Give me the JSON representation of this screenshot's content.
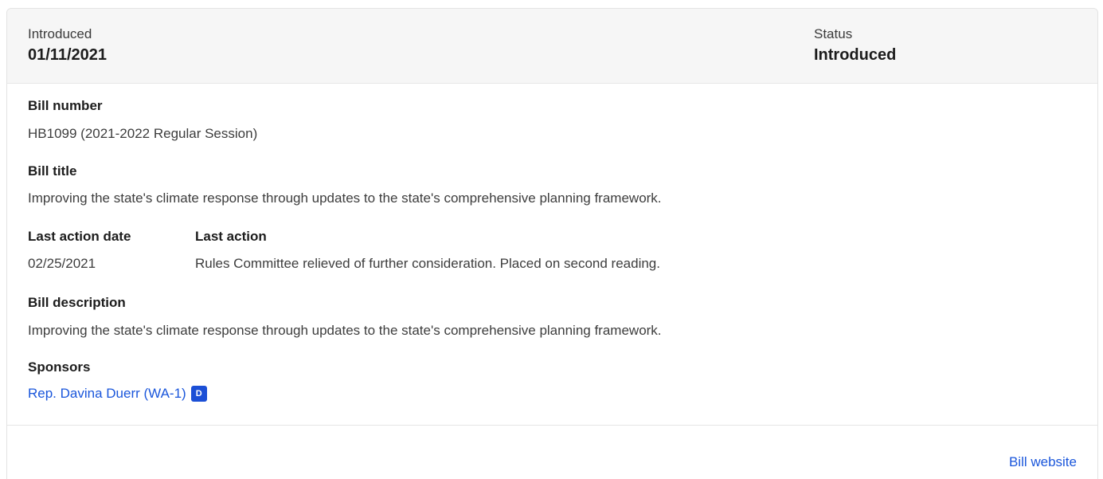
{
  "header": {
    "introduced_label": "Introduced",
    "introduced_value": "01/11/2021",
    "status_label": "Status",
    "status_value": "Introduced"
  },
  "fields": {
    "bill_number_label": "Bill number",
    "bill_number_value": "HB1099 (2021-2022 Regular Session)",
    "bill_title_label": "Bill title",
    "bill_title_value": "Improving the state's climate response through updates to the state's comprehensive planning framework.",
    "last_action_date_label": "Last action date",
    "last_action_date_value": "02/25/2021",
    "last_action_label": "Last action",
    "last_action_value": "Rules Committee relieved of further consideration. Placed on second reading.",
    "bill_description_label": "Bill description",
    "bill_description_value": "Improving the state's climate response through updates to the state's comprehensive planning framework.",
    "sponsors_label": "Sponsors"
  },
  "sponsors": [
    {
      "name": "Rep. Davina Duerr (WA-1)",
      "party": "D"
    }
  ],
  "footer": {
    "bill_website_label": "Bill website"
  },
  "colors": {
    "link": "#1a56db",
    "party_badge_democrat": "#1b4fd6",
    "header_bg": "#f6f6f6"
  }
}
